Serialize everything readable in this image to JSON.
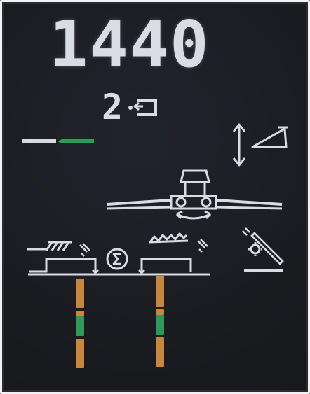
{
  "display": {
    "rpm_value": "1440",
    "gear_value": "2"
  },
  "indicators": {
    "speed_bar": {
      "name": "speed-bar",
      "colors": {
        "left": "#d7dbe1",
        "right": "#2e9a57"
      }
    },
    "sieve_left_bar": {
      "segments": [
        {
          "color": "#c9873e"
        },
        {
          "color": "#c9873e"
        },
        {
          "color": "#2e9a57"
        },
        {
          "color": "#c9873e"
        }
      ]
    },
    "sieve_right_bar": {
      "segments": [
        {
          "color": "#c9873e"
        },
        {
          "color": "#c9873e"
        },
        {
          "color": "#2e9a57"
        },
        {
          "color": "#c9873e"
        }
      ]
    }
  },
  "icons": {
    "gear_arrow": "gear-arrow-icon",
    "header_up_down": "up-down-arrow-icon",
    "header_tilt": "header-tilt-icon",
    "tractor_spreader": "spreader-icon",
    "sum": "sum-icon",
    "chaff_left": "chaff-left-icon",
    "chaff_right": "chaff-right-icon",
    "rotor_tool": "rotor-tool-icon"
  },
  "theme": {
    "background": "#1b1d22",
    "lcd_white": "#d8dde4",
    "accent_green": "#2e9a57",
    "accent_orange": "#c9873e"
  }
}
